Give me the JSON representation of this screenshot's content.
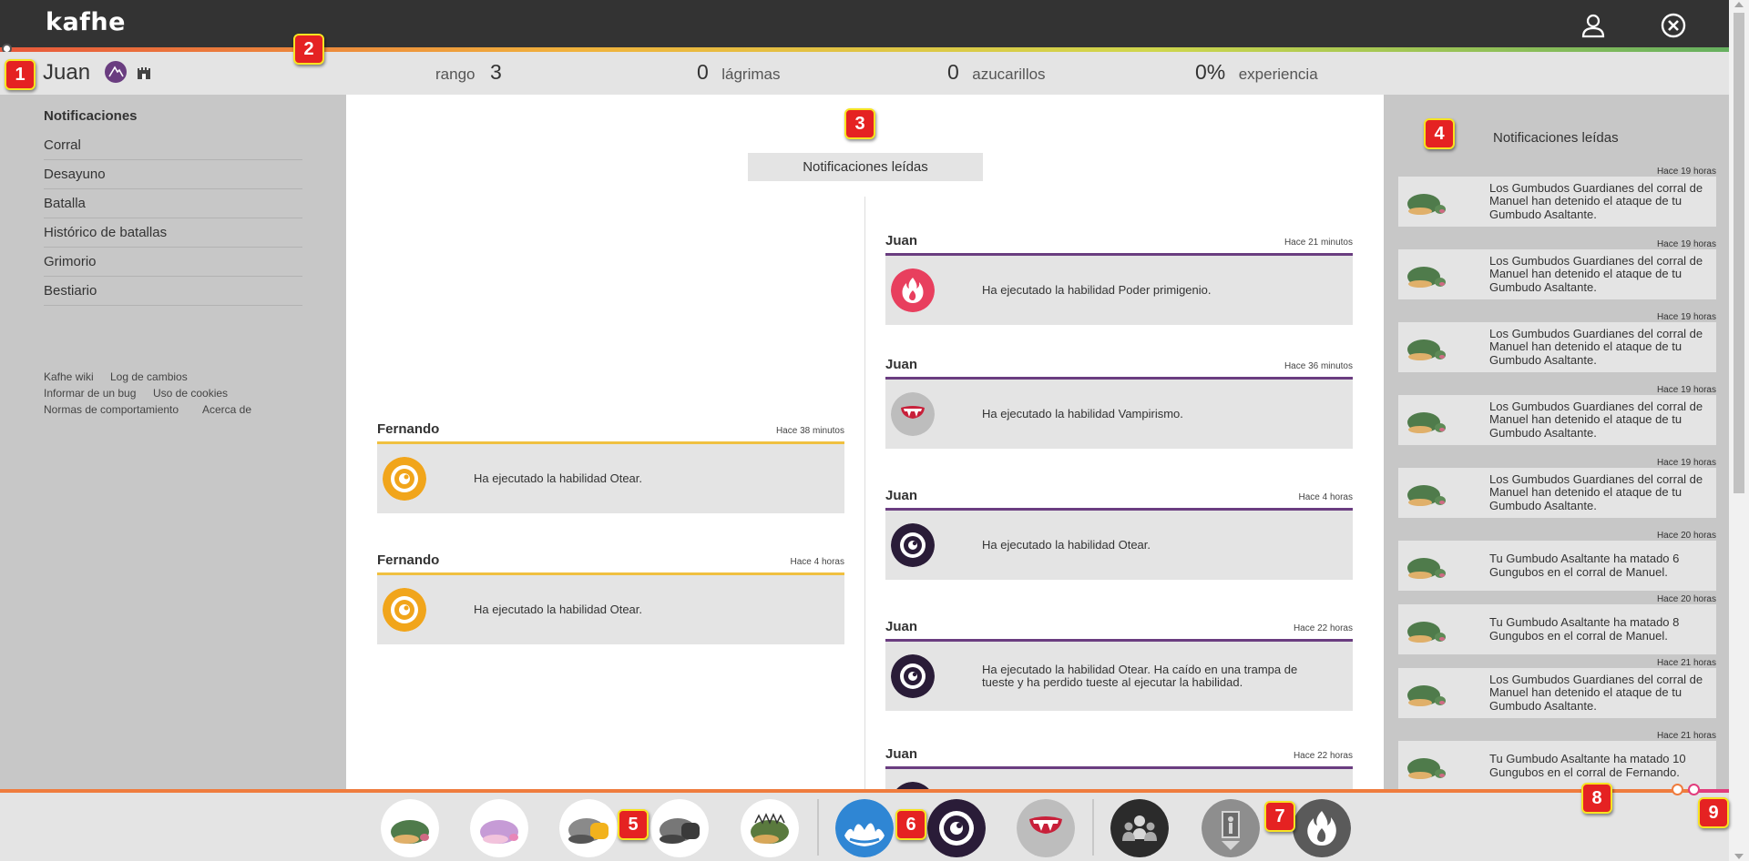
{
  "app": {
    "logo": "kafhe"
  },
  "header": {
    "icons": [
      "user-icon",
      "close-circle-icon"
    ]
  },
  "status": {
    "username": "Juan",
    "badges": [
      "mountain-badge-icon",
      "castle-badge-icon"
    ],
    "stats": [
      {
        "value": "3",
        "label": "rango"
      },
      {
        "value": "0",
        "label": "lágrimas"
      },
      {
        "value": "0",
        "label": "azucarillos"
      },
      {
        "value": "0%",
        "label": "experiencia"
      }
    ]
  },
  "sidebar": {
    "items": [
      {
        "label": "Notificaciones",
        "active": true
      },
      {
        "label": "Corral"
      },
      {
        "label": "Desayuno"
      },
      {
        "label": "Batalla"
      },
      {
        "label": "Histórico de batallas"
      },
      {
        "label": "Grimorio"
      },
      {
        "label": "Bestiario"
      }
    ],
    "footer_links": [
      "Kafhe wiki",
      "Log de cambios",
      "Informar de un bug",
      "Uso de cookies",
      "Normas de comportamiento",
      "Acerca de"
    ]
  },
  "main": {
    "title": "Notificaciones leídas",
    "left_column": [
      {
        "who": "Fernando",
        "when": "Hace 38 minutos",
        "text": "Ha ejecutado la habilidad Otear.",
        "icon": "otear-orange-icon",
        "color": "#f0c040"
      },
      {
        "who": "Fernando",
        "when": "Hace 4 horas",
        "text": "Ha ejecutado la habilidad Otear.",
        "icon": "otear-orange-icon",
        "color": "#f0c040"
      }
    ],
    "right_column": [
      {
        "who": "Juan",
        "when": "Hace 21 minutos",
        "text": "Ha ejecutado la habilidad Poder primigenio.",
        "icon": "flame-icon",
        "color": "#6a3d80"
      },
      {
        "who": "Juan",
        "when": "Hace 36 minutos",
        "text": "Ha ejecutado la habilidad Vampirismo.",
        "icon": "vampire-mouth-icon",
        "color": "#6a3d80"
      },
      {
        "who": "Juan",
        "when": "Hace 4 horas",
        "text": "Ha ejecutado la habilidad Otear.",
        "icon": "otear-purple-icon",
        "color": "#6a3d80"
      },
      {
        "who": "Juan",
        "when": "Hace 22 horas",
        "text": "Ha ejecutado la habilidad Otear. Ha caído en una trampa de tueste y ha perdido tueste al ejecutar la habilidad.",
        "icon": "otear-purple-icon",
        "color": "#6a3d80"
      },
      {
        "who": "Juan",
        "when": "Hace 22 horas",
        "text": "",
        "icon": "otear-purple-icon",
        "color": "#6a3d80"
      }
    ]
  },
  "right_panel": {
    "title": "Notificaciones leídas",
    "items": [
      {
        "when": "Hace 19 horas",
        "text": "Los Gumbudos Guardianes del corral de Manuel han detenido el ataque de tu Gumbudo Asaltante."
      },
      {
        "when": "Hace 19 horas",
        "text": "Los Gumbudos Guardianes del corral de Manuel han detenido el ataque de tu Gumbudo Asaltante."
      },
      {
        "when": "Hace 19 horas",
        "text": "Los Gumbudos Guardianes del corral de Manuel han detenido el ataque de tu Gumbudo Asaltante."
      },
      {
        "when": "Hace 19 horas",
        "text": "Los Gumbudos Guardianes del corral de Manuel han detenido el ataque de tu Gumbudo Asaltante."
      },
      {
        "when": "Hace 19 horas",
        "text": "Los Gumbudos Guardianes del corral de Manuel han detenido el ataque de tu Gumbudo Asaltante."
      },
      {
        "when": "Hace 20 horas",
        "text": "Tu Gumbudo Asaltante ha matado 6 Gungubos en el corral de Manuel."
      },
      {
        "when": "Hace 20 horas",
        "text": "Tu Gumbudo Asaltante ha matado 8 Gungubos en el corral de Manuel."
      },
      {
        "when": "Hace 21 horas",
        "text": "Los Gumbudos Guardianes del corral de Manuel han detenido el ataque de tu Gumbudo Asaltante."
      },
      {
        "when": "Hace 21 horas",
        "text": "Tu Gumbudo Asaltante ha matado 10 Gungubos en el corral de Fernando."
      }
    ]
  },
  "bottom_bar": {
    "creatures": [
      "green-gumbudo-icon",
      "pink-gumbudo-icon",
      "armored-gumbudo-icon",
      "dark-armored-gumbudo-icon",
      "spiky-gumbudo-icon"
    ],
    "skills": [
      "water-splash-skill-icon",
      "otear-skill-icon",
      "vampirismo-skill-icon"
    ],
    "actions": [
      "group-action-icon",
      "exit-door-action-icon",
      "flame-action-icon"
    ]
  },
  "markers": [
    "1",
    "2",
    "3",
    "4",
    "5",
    "6",
    "7",
    "8",
    "9"
  ]
}
